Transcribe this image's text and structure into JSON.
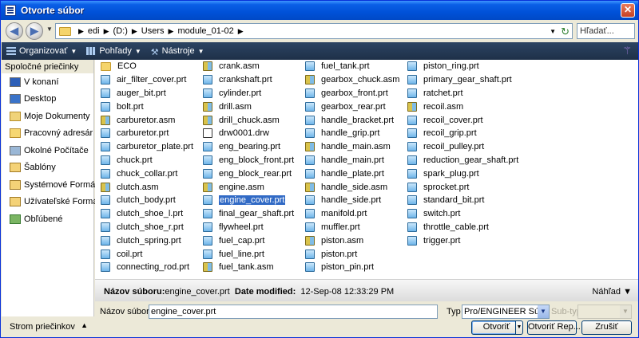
{
  "window": {
    "title": "Otvorte súbor"
  },
  "address": {
    "crumbs": [
      "edi",
      "(D:)",
      "Users",
      "module_01-02"
    ],
    "search_placeholder": "Hľadať..."
  },
  "toolbar": {
    "organize": "Organizovať",
    "views": "Pohľady",
    "tools": "Nástroje"
  },
  "sidebar": {
    "header": "Spoločné priečinky",
    "items": [
      {
        "label": "V konaní",
        "icon": "in-session-icon"
      },
      {
        "label": "Desktop",
        "icon": "desktop-icon"
      },
      {
        "label": "Moje Dokumenty",
        "icon": "my-documents-icon"
      },
      {
        "label": "Pracovný adresár",
        "icon": "working-directory-icon"
      },
      {
        "label": "Okolné Počítače",
        "icon": "network-icon"
      },
      {
        "label": "Šablóny",
        "icon": "templates-icon"
      },
      {
        "label": "Systémové Formáty",
        "icon": "system-formats-icon"
      },
      {
        "label": "Užívateľské Formáty",
        "icon": "user-formats-icon"
      },
      {
        "label": "Obľúbené",
        "icon": "favorites-icon"
      }
    ],
    "footer": "Strom priečinkov"
  },
  "files": {
    "columns": [
      [
        {
          "name": "ECO",
          "type": "folder"
        },
        {
          "name": "air_filter_cover.prt",
          "type": "prt"
        },
        {
          "name": "auger_bit.prt",
          "type": "prt"
        },
        {
          "name": "bolt.prt",
          "type": "prt"
        },
        {
          "name": "carburetor.asm",
          "type": "asm"
        },
        {
          "name": "carburetor.prt",
          "type": "prt"
        },
        {
          "name": "carburetor_plate.prt",
          "type": "prt"
        },
        {
          "name": "chuck.prt",
          "type": "prt"
        },
        {
          "name": "chuck_collar.prt",
          "type": "prt"
        },
        {
          "name": "clutch.asm",
          "type": "asm"
        },
        {
          "name": "clutch_body.prt",
          "type": "prt"
        },
        {
          "name": "clutch_shoe_l.prt",
          "type": "prt"
        },
        {
          "name": "clutch_shoe_r.prt",
          "type": "prt"
        },
        {
          "name": "clutch_spring.prt",
          "type": "prt"
        },
        {
          "name": "coil.prt",
          "type": "prt"
        },
        {
          "name": "connecting_rod.prt",
          "type": "prt"
        }
      ],
      [
        {
          "name": "crank.asm",
          "type": "asm"
        },
        {
          "name": "crankshaft.prt",
          "type": "prt"
        },
        {
          "name": "cylinder.prt",
          "type": "prt"
        },
        {
          "name": "drill.asm",
          "type": "asm"
        },
        {
          "name": "drill_chuck.asm",
          "type": "asm"
        },
        {
          "name": "drw0001.drw",
          "type": "drw"
        },
        {
          "name": "eng_bearing.prt",
          "type": "prt"
        },
        {
          "name": "eng_block_front.prt",
          "type": "prt"
        },
        {
          "name": "eng_block_rear.prt",
          "type": "prt"
        },
        {
          "name": "engine.asm",
          "type": "asm"
        },
        {
          "name": "engine_cover.prt",
          "type": "prt",
          "selected": true
        },
        {
          "name": "final_gear_shaft.prt",
          "type": "prt"
        },
        {
          "name": "flywheel.prt",
          "type": "prt"
        },
        {
          "name": "fuel_cap.prt",
          "type": "prt"
        },
        {
          "name": "fuel_line.prt",
          "type": "prt"
        },
        {
          "name": "fuel_tank.asm",
          "type": "asm"
        }
      ],
      [
        {
          "name": "fuel_tank.prt",
          "type": "prt"
        },
        {
          "name": "gearbox_chuck.asm",
          "type": "asm"
        },
        {
          "name": "gearbox_front.prt",
          "type": "prt"
        },
        {
          "name": "gearbox_rear.prt",
          "type": "prt"
        },
        {
          "name": "handle_bracket.prt",
          "type": "prt"
        },
        {
          "name": "handle_grip.prt",
          "type": "prt"
        },
        {
          "name": "handle_main.asm",
          "type": "asm"
        },
        {
          "name": "handle_main.prt",
          "type": "prt"
        },
        {
          "name": "handle_plate.prt",
          "type": "prt"
        },
        {
          "name": "handle_side.asm",
          "type": "asm"
        },
        {
          "name": "handle_side.prt",
          "type": "prt"
        },
        {
          "name": "manifold.prt",
          "type": "prt"
        },
        {
          "name": "muffler.prt",
          "type": "prt"
        },
        {
          "name": "piston.asm",
          "type": "asm"
        },
        {
          "name": "piston.prt",
          "type": "prt"
        },
        {
          "name": "piston_pin.prt",
          "type": "prt"
        }
      ],
      [
        {
          "name": "piston_ring.prt",
          "type": "prt"
        },
        {
          "name": "primary_gear_shaft.prt",
          "type": "prt"
        },
        {
          "name": "ratchet.prt",
          "type": "prt"
        },
        {
          "name": "recoil.asm",
          "type": "asm"
        },
        {
          "name": "recoil_cover.prt",
          "type": "prt"
        },
        {
          "name": "recoil_grip.prt",
          "type": "prt"
        },
        {
          "name": "recoil_pulley.prt",
          "type": "prt"
        },
        {
          "name": "reduction_gear_shaft.prt",
          "type": "prt"
        },
        {
          "name": "spark_plug.prt",
          "type": "prt"
        },
        {
          "name": "sprocket.prt",
          "type": "prt"
        },
        {
          "name": "standard_bit.prt",
          "type": "prt"
        },
        {
          "name": "switch.prt",
          "type": "prt"
        },
        {
          "name": "throttle_cable.prt",
          "type": "prt"
        },
        {
          "name": "trigger.prt",
          "type": "prt"
        }
      ]
    ]
  },
  "details": {
    "name_label": "Názov súboru:",
    "name_value": "engine_cover.prt",
    "modified_label": "Date modified:",
    "modified_value": "12-Sep-08 12:33:29 PM",
    "preview": "Náhľad"
  },
  "bottom": {
    "filename_label": "Názov súboru:",
    "filename_value": "engine_cover.prt",
    "type_label": "Typ",
    "type_value": "Pro/ENGINEER Súbor",
    "subtype_label": "Sub-typ",
    "open": "Otvoriť",
    "open_rep": "Otvoriť Rep...",
    "cancel": "Zrušiť"
  }
}
